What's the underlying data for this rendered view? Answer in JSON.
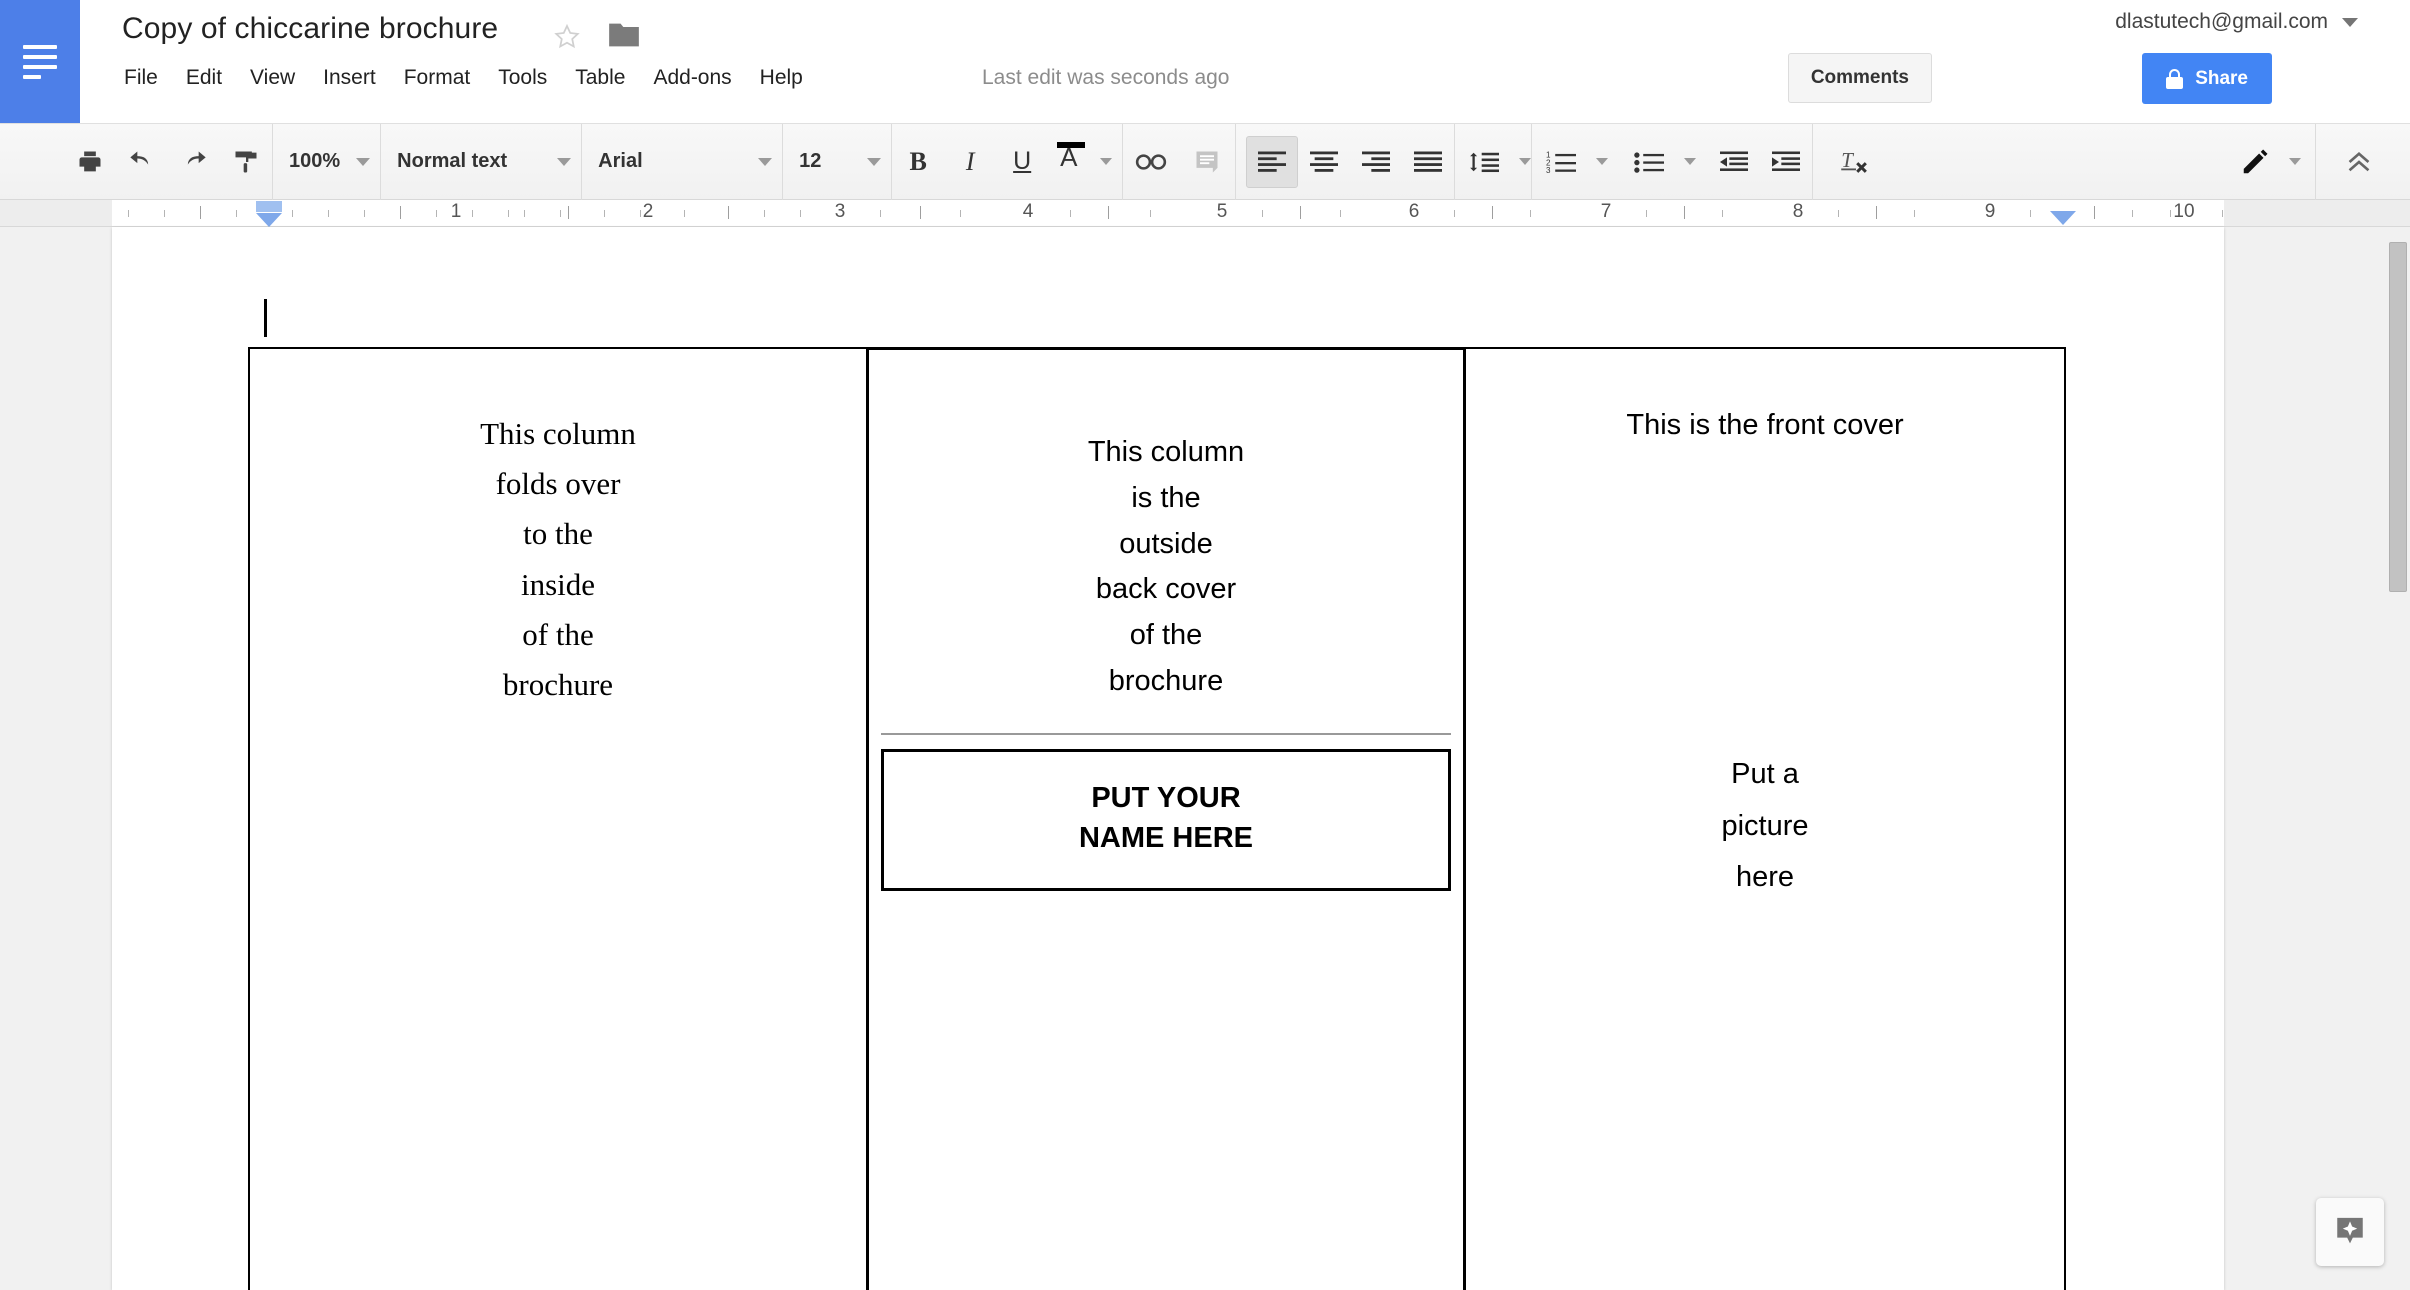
{
  "header": {
    "logo_icon": "docs-logo-icon",
    "doc_title": "Copy of chiccarine brochure",
    "star_icon": "star-outline-icon",
    "folder_icon": "folder-icon",
    "menus": [
      "File",
      "Edit",
      "View",
      "Insert",
      "Format",
      "Tools",
      "Table",
      "Add-ons",
      "Help"
    ],
    "last_edit": "Last edit was seconds ago",
    "account_email": "dlastutech@gmail.com",
    "account_caret_icon": "chevron-down-icon",
    "comments_label": "Comments",
    "share_label": "Share",
    "share_lock_icon": "lock-icon",
    "colors": {
      "logo_blue": "#4d7fe8",
      "share_blue": "#4285f4"
    }
  },
  "toolbar": {
    "print_icon": "print-icon",
    "undo_icon": "undo-icon",
    "redo_icon": "redo-icon",
    "paint_format_icon": "paint-format-icon",
    "zoom_value": "100%",
    "style_value": "Normal text",
    "font_value": "Arial",
    "font_size_value": "12",
    "bold_label": "B",
    "italic_label": "I",
    "underline_label": "U",
    "text_color_label": "A",
    "text_color_swatch": "#000000",
    "link_icon": "link-icon",
    "comment_icon": "add-comment-icon",
    "align_left_icon": "align-left-icon",
    "align_center_icon": "align-center-icon",
    "align_right_icon": "align-right-icon",
    "align_justify_icon": "align-justify-icon",
    "line_spacing_icon": "line-spacing-icon",
    "numbered_list_icon": "numbered-list-icon",
    "bulleted_list_icon": "bulleted-list-icon",
    "decrease_indent_icon": "decrease-indent-icon",
    "increase_indent_icon": "increase-indent-icon",
    "clear_formatting_icon": "clear-formatting-icon",
    "edit_mode_icon": "pencil-icon",
    "collapse_icon": "chevron-up-double-icon"
  },
  "ruler": {
    "numbers": [
      "1",
      "2",
      "3",
      "4",
      "5",
      "6",
      "7",
      "8",
      "9",
      "10"
    ],
    "left_indent_marker": "left-indent-marker",
    "right_indent_marker": "right-indent-marker"
  },
  "document": {
    "columns": [
      {
        "name": "inside-fold-column",
        "lines": [
          "This column",
          "folds over",
          "to the",
          "inside",
          "of the",
          "brochure"
        ]
      },
      {
        "name": "outside-back-cover-column",
        "lines": [
          "This column",
          "is the",
          "outside",
          "back cover",
          "of the",
          "brochure"
        ],
        "name_box_lines": [
          "PUT YOUR",
          "NAME HERE"
        ]
      },
      {
        "name": "front-cover-column",
        "title": "This is the front cover",
        "picture_lines": [
          "Put a",
          "picture",
          "here"
        ]
      }
    ]
  },
  "explore": {
    "icon": "explore-sparkle-icon"
  },
  "scrollbar": {
    "thumb": "vertical-scrollbar-thumb"
  }
}
